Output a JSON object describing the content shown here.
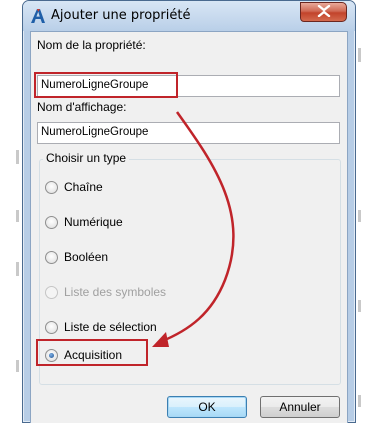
{
  "dialog": {
    "title": "Ajouter une propriété",
    "close_symbol": "✕"
  },
  "fields": {
    "property_name_label": "Nom de la propriété:",
    "property_name_value": "NumeroLigneGroupe",
    "display_name_label": "Nom d'affichage:",
    "display_name_value": "NumeroLigneGroupe"
  },
  "type_group": {
    "title": "Choisir un type",
    "options": [
      {
        "label": "Chaîne",
        "checked": false,
        "disabled": false
      },
      {
        "label": "Numérique",
        "checked": false,
        "disabled": false
      },
      {
        "label": "Booléen",
        "checked": false,
        "disabled": false
      },
      {
        "label": "Liste des symboles",
        "checked": false,
        "disabled": true
      },
      {
        "label": "Liste de sélection",
        "checked": false,
        "disabled": false
      },
      {
        "label": "Acquisition",
        "checked": true,
        "disabled": false
      }
    ]
  },
  "buttons": {
    "ok": "OK",
    "cancel": "Annuler"
  },
  "colors": {
    "annotation_red": "#c0242a",
    "window_frame": "#b7cde6",
    "close_button": "#c2432b"
  },
  "icons": {
    "app": "autocad-a-icon",
    "close": "close-icon"
  }
}
